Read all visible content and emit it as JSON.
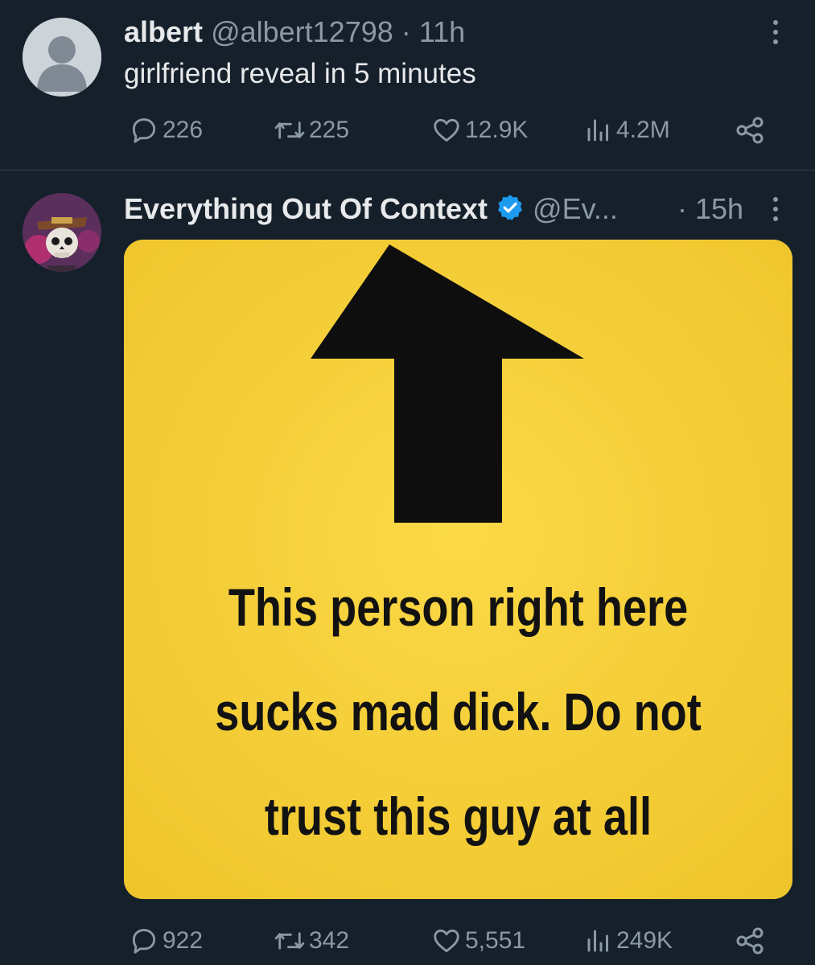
{
  "tweet1": {
    "name": "albert",
    "handle": "@albert12798",
    "separator": "·",
    "time": "11h",
    "text": "girlfriend reveal in 5 minutes",
    "replies": "226",
    "reposts": "225",
    "likes": "12.9K",
    "views": "4.2M"
  },
  "tweet2": {
    "name": "Everything Out Of Context",
    "handle": "@Ev...",
    "separator": "·",
    "time": "15h",
    "sign_lines": [
      "This person right here",
      "sucks mad dick. Do not",
      "trust this guy at all"
    ],
    "replies": "922",
    "reposts": "342",
    "likes": "5,551",
    "views": "249K"
  },
  "colors": {
    "background": "#15202b",
    "muted": "#8b98a5",
    "verified": "#1d9bf0",
    "sign_yellow": "#f7d13a"
  },
  "icons": [
    "reply-icon",
    "repost-icon",
    "like-icon",
    "views-icon",
    "share-icon",
    "more-icon",
    "verified-badge-icon"
  ]
}
